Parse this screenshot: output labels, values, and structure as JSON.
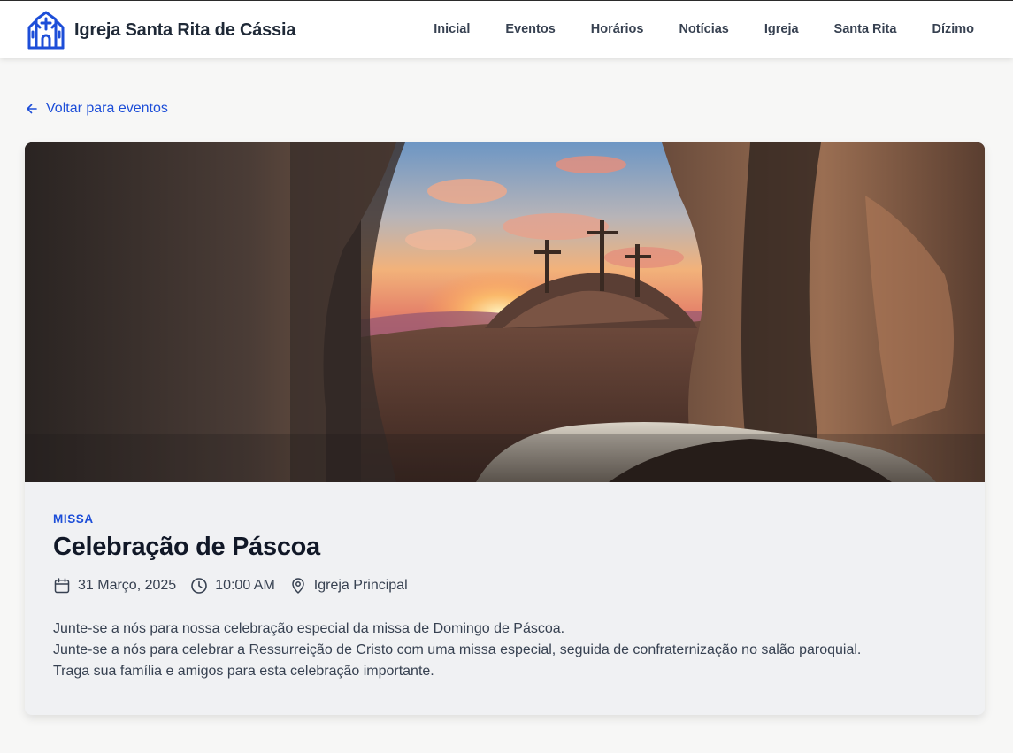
{
  "header": {
    "brand_name": "Igreja Santa Rita de Cássia",
    "brand_icon": "church-icon",
    "nav": [
      {
        "label": "Inicial"
      },
      {
        "label": "Eventos"
      },
      {
        "label": "Horários"
      },
      {
        "label": "Notícias"
      },
      {
        "label": "Igreja"
      },
      {
        "label": "Santa Rita"
      },
      {
        "label": "Dízimo"
      }
    ]
  },
  "back_link": {
    "label": "Voltar para eventos",
    "icon": "arrow-left-icon"
  },
  "event": {
    "image_icon": "easter-calvary-image",
    "category": "MISSA",
    "title": "Celebração de Páscoa",
    "date": "31 Março, 2025",
    "time": "10:00 AM",
    "location": "Igreja Principal",
    "description": [
      "Junte-se a nós para nossa celebração especial da missa de Domingo de Páscoa.",
      "Junte-se a nós para celebrar a Ressurreição de Cristo com uma missa especial, seguida de confraternização no salão paroquial.",
      "Traga sua família e amigos para esta celebração importante."
    ]
  },
  "colors": {
    "accent": "#1d4ed8",
    "background": "#f7f7f6",
    "card": "#f0f1f3",
    "text": "#111827"
  }
}
